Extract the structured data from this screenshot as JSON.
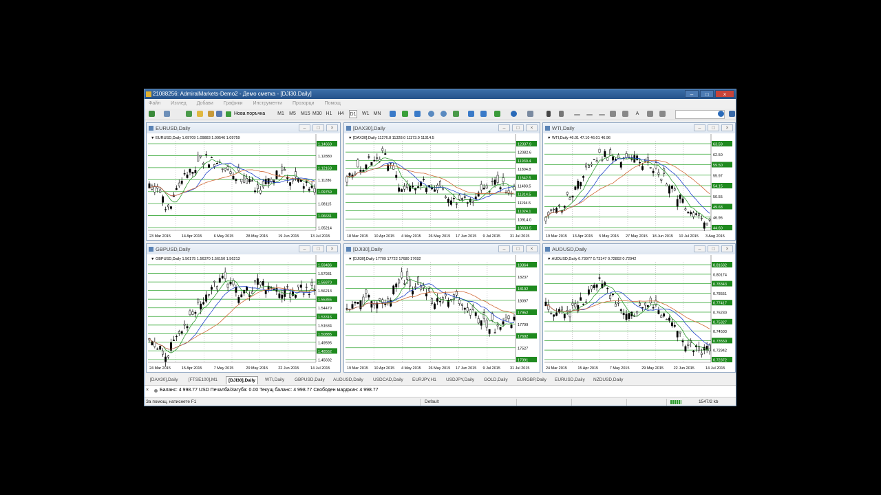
{
  "window": {
    "title": "21088256: AdmiralMarkets-Demo2 - Демо сметка - [DJI30,Daily]",
    "buttons": [
      "–",
      "□",
      "×"
    ]
  },
  "menu": [
    "Файл",
    "Изглед",
    "Добави",
    "Графики",
    "Инструменти",
    "Прозорци",
    "Помощ"
  ],
  "toolbar": {
    "new_order_label": "Нова поръчка",
    "timeframes": [
      "M1",
      "M5",
      "M15",
      "M30",
      "H1",
      "H4",
      "D1",
      "W1",
      "MN"
    ],
    "text_tool": "A"
  },
  "colors": {
    "bull": "#00aa00",
    "bear": "#000000",
    "ma_fast": "#2f9a2f",
    "ma_mid": "#2244cc",
    "ma_slow": "#d26a38",
    "hline": "#3aaa3a",
    "label_bg": "#1f8a1f"
  },
  "charts": [
    {
      "id": "eurusd",
      "title": "EURUSD,Daily",
      "header": "EURUSD,Daily  1.09709  1.09883  1.09546  1.09759",
      "price_labels": [
        "1.14660",
        "1.12880",
        "1.12163",
        "1.11286",
        "1.09759",
        "1.08115",
        "1.06631",
        "1.05214"
      ],
      "date_labels": [
        "23 Mar 2015",
        "14 Apr 2015",
        "6 May 2015",
        "28 May 2015",
        "19 Jun 2015",
        "13 Jul 2015"
      ]
    },
    {
      "id": "dax30",
      "title": "[DAX30],Daily",
      "header": "[DAX30],Daily  11276.8  11328.0  11173.0  11314.5",
      "price_labels": [
        "12337.9",
        "12082.6",
        "11930.4",
        "11804.8",
        "11642.5",
        "11483.5",
        "11314.5",
        "11194.5",
        "11024.1",
        "10914.0",
        "10633.5"
      ],
      "date_labels": [
        "18 Mar 2015",
        "10 Apr 2015",
        "4 May 2015",
        "26 May 2015",
        "17 Jun 2015",
        "9 Jul 2015",
        "31 Jul 2015"
      ]
    },
    {
      "id": "wti",
      "title": "WTI,Daily",
      "header": "WTI,Daily  46.01  47.10  46.01  46.96",
      "price_labels": [
        "63.59",
        "62.50",
        "59.50",
        "55.97",
        "54.15",
        "50.55",
        "49.68",
        "46.96",
        "44.60"
      ],
      "date_labels": [
        "19 Mar 2015",
        "13 Apr 2015",
        "5 May 2015",
        "27 May 2015",
        "18 Jun 2015",
        "10 Jul 2015",
        "3 Aug 2015"
      ]
    },
    {
      "id": "gbpusd",
      "title": "GBPUSD,Daily",
      "header": "GBPUSD,Daily  1.56175  1.56370  1.56150  1.56213",
      "price_labels": [
        "1.59486",
        "1.57931",
        "1.56870",
        "1.56213",
        "1.55365",
        "1.54479",
        "1.53316",
        "1.51634",
        "1.50885",
        "1.49595",
        "1.48562",
        "1.45692"
      ],
      "date_labels": [
        "24 Mar 2015",
        "15 Apr 2015",
        "7 May 2015",
        "29 May 2015",
        "22 Jun 2015",
        "14 Jul 2015"
      ]
    },
    {
      "id": "dji30",
      "title": "[DJI30],Daily",
      "header": "[DJI30],Daily  17709  17722  17680  17692",
      "price_labels": [
        "18364",
        "18237",
        "18192",
        "18097",
        "17952",
        "17799",
        "17692",
        "17527",
        "17391"
      ],
      "date_labels": [
        "19 Mar 2015",
        "10 Apr 2015",
        "4 May 2015",
        "26 May 2015",
        "17 Jun 2015",
        "9 Jul 2015",
        "31 Jul 2015"
      ]
    },
    {
      "id": "audusd",
      "title": "AUDUSD,Daily",
      "header": "AUDUSD,Daily  0.73077  0.73147  0.72892  0.72942",
      "price_labels": [
        "0.81632",
        "0.80174",
        "0.78343",
        "0.78551",
        "0.77417",
        "0.76230",
        "0.75327",
        "0.74503",
        "0.73550",
        "0.72942",
        "0.72372"
      ],
      "date_labels": [
        "24 Mar 2015",
        "15 Apr 2015",
        "7 May 2015",
        "29 May 2015",
        "22 Jun 2015",
        "14 Jul 2015"
      ]
    }
  ],
  "tabs": [
    "[DAX30],Daily",
    "[FTSE100],M1",
    "[DJI30],Daily",
    "WTI,Daily",
    "GBPUSD,Daily",
    "AUDUSD,Daily",
    "USDCAD,Daily",
    "EURJPY,H1",
    "USDJPY,Daily",
    "GOLD,Daily",
    "EURGBP,Daily",
    "EURUSD,Daily",
    "NZDUSD,Daily"
  ],
  "active_tab": "[DJI30],Daily",
  "terminal": {
    "balance_line": "Баланс: 4 998.77 USD  Печалба/Загуба: 0.00  Текущ баланс: 4 998.77  Свободен марджин: 4 998.77"
  },
  "status": {
    "help": "За помощ, натиснете F1",
    "profile": "Default",
    "traffic": "1547/2 kb"
  }
}
